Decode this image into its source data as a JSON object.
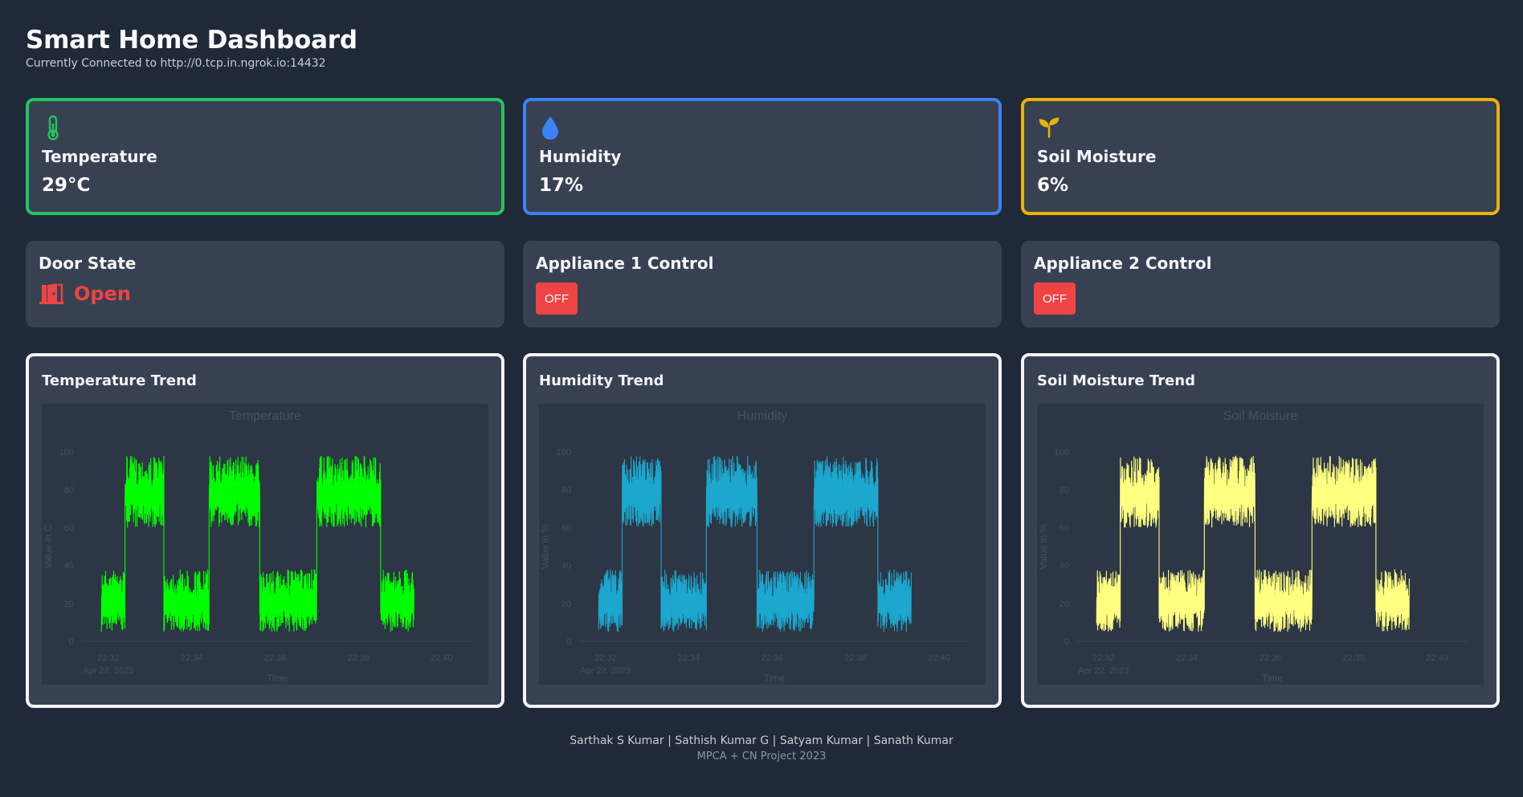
{
  "header": {
    "title": "Smart Home Dashboard",
    "subtitle": "Currently Connected to http://0.tcp.in.ngrok.io:14432"
  },
  "stats": [
    {
      "label": "Temperature",
      "value": "29°C",
      "icon": "thermometer-icon",
      "color": "#22c55e"
    },
    {
      "label": "Humidity",
      "value": "17%",
      "icon": "droplet-icon",
      "color": "#3b82f6"
    },
    {
      "label": "Soil Moisture",
      "value": "6%",
      "icon": "seedling-icon",
      "color": "#eab308"
    }
  ],
  "controls": {
    "door": {
      "label": "Door State",
      "state": "Open",
      "icon": "door-open-icon",
      "color": "#ef4444"
    },
    "appliance1": {
      "label": "Appliance 1 Control",
      "button": "OFF"
    },
    "appliance2": {
      "label": "Appliance 2 Control",
      "button": "OFF"
    }
  },
  "trends": [
    {
      "label": "Temperature Trend",
      "border": "#22c55e"
    },
    {
      "label": "Humidity Trend",
      "border": "#3b82f6"
    },
    {
      "label": "Soil Moisture Trend",
      "border": "#eab308"
    }
  ],
  "chart_data": [
    {
      "type": "line",
      "title": "Temperature",
      "xlabel": "Time",
      "ylabel": "Value in C",
      "ylim": [
        0,
        100
      ],
      "yticks": [
        0,
        20,
        40,
        60,
        80,
        100
      ],
      "xticks": [
        "22:32\nApr 22, 2023",
        "22:34",
        "22:36",
        "22:38",
        "22:40"
      ],
      "color": "#00ff00",
      "series": [
        {
          "segments": [
            {
              "x0": "22:31:50",
              "x1": "22:32:24",
              "low": 5,
              "high": 38
            },
            {
              "x0": "22:32:24",
              "x1": "22:33:20",
              "low": 60,
              "high": 98
            },
            {
              "x0": "22:33:20",
              "x1": "22:34:25",
              "low": 5,
              "high": 38
            },
            {
              "x0": "22:34:25",
              "x1": "22:35:38",
              "low": 60,
              "high": 98
            },
            {
              "x0": "22:35:38",
              "x1": "22:37:00",
              "low": 5,
              "high": 38
            },
            {
              "x0": "22:37:00",
              "x1": "22:38:32",
              "low": 60,
              "high": 98
            },
            {
              "x0": "22:38:32",
              "x1": "22:39:20",
              "low": 5,
              "high": 38
            }
          ]
        }
      ]
    },
    {
      "type": "line",
      "title": "Humidity",
      "xlabel": "Time",
      "ylabel": "Value in %",
      "ylim": [
        0,
        100
      ],
      "yticks": [
        0,
        20,
        40,
        60,
        80,
        100
      ],
      "xticks": [
        "22:32\nApr 22, 2023",
        "22:34",
        "22:36",
        "22:38",
        "22:40"
      ],
      "color": "#1ca7cf",
      "series": [
        {
          "segments": [
            {
              "x0": "22:31:50",
              "x1": "22:32:24",
              "low": 5,
              "high": 38
            },
            {
              "x0": "22:32:24",
              "x1": "22:33:20",
              "low": 60,
              "high": 98
            },
            {
              "x0": "22:33:20",
              "x1": "22:34:25",
              "low": 5,
              "high": 38
            },
            {
              "x0": "22:34:25",
              "x1": "22:35:38",
              "low": 60,
              "high": 98
            },
            {
              "x0": "22:35:38",
              "x1": "22:37:00",
              "low": 5,
              "high": 38
            },
            {
              "x0": "22:37:00",
              "x1": "22:38:32",
              "low": 60,
              "high": 98
            },
            {
              "x0": "22:38:32",
              "x1": "22:39:20",
              "low": 5,
              "high": 38
            }
          ]
        }
      ]
    },
    {
      "type": "line",
      "title": "Soil Moisture",
      "xlabel": "Time",
      "ylabel": "Value in %",
      "ylim": [
        0,
        100
      ],
      "yticks": [
        0,
        20,
        40,
        60,
        80,
        100
      ],
      "xticks": [
        "22:32\nApr 22, 2023",
        "22:34",
        "22:36",
        "22:38",
        "22:40"
      ],
      "color": "#ffff80",
      "series": [
        {
          "segments": [
            {
              "x0": "22:31:50",
              "x1": "22:32:24",
              "low": 5,
              "high": 38
            },
            {
              "x0": "22:32:24",
              "x1": "22:33:20",
              "low": 60,
              "high": 98
            },
            {
              "x0": "22:33:20",
              "x1": "22:34:25",
              "low": 5,
              "high": 38
            },
            {
              "x0": "22:34:25",
              "x1": "22:35:38",
              "low": 60,
              "high": 98
            },
            {
              "x0": "22:35:38",
              "x1": "22:37:00",
              "low": 5,
              "high": 38
            },
            {
              "x0": "22:37:00",
              "x1": "22:38:32",
              "low": 60,
              "high": 98
            },
            {
              "x0": "22:38:32",
              "x1": "22:39:20",
              "low": 5,
              "high": 38
            }
          ]
        }
      ]
    }
  ],
  "footer": {
    "authors": "Sarthak S Kumar | Sathish Kumar G | Satyam Kumar | Sanath Kumar",
    "project": "MPCA + CN Project 2023"
  }
}
